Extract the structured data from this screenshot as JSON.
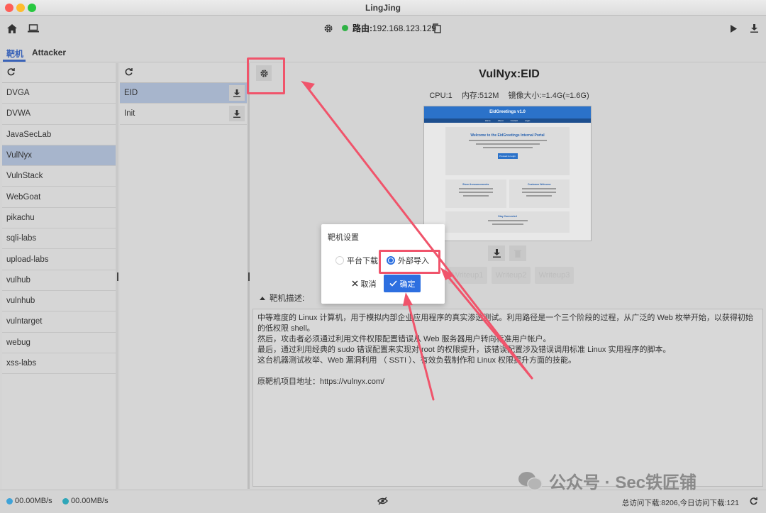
{
  "window": {
    "title": "LingJing"
  },
  "toolbar": {
    "route_label": "路由:",
    "route_ip": "192.168.123.129"
  },
  "tabs": [
    {
      "label": "靶机",
      "active": true
    },
    {
      "label": "Attacker",
      "active": false
    }
  ],
  "targets": {
    "items": [
      "DVGA",
      "DVWA",
      "JavaSecLab",
      "VulNyx",
      "VulnStack",
      "WebGoat",
      "pikachu",
      "sqli-labs",
      "upload-labs",
      "vulhub",
      "vulnhub",
      "vulntarget",
      "webug",
      "xss-labs"
    ],
    "selected": "VulNyx"
  },
  "machines": {
    "items": [
      "EID",
      "Init"
    ],
    "selected": "EID"
  },
  "vm": {
    "title": "VulNyx:EID",
    "cpu": "CPU:1",
    "memory": "内存:512M",
    "image_size": "镜像大小:≈1.4G(≈1.6G)"
  },
  "preview": {
    "header": "EidGreetings v1.0",
    "nav": [
      "Home",
      "About",
      "Contact",
      "Login"
    ],
    "welcome": "Welcome to the EidGreetings Internal Portal",
    "button": "Proceed to Login",
    "left_heading": "Store Announcements",
    "right_heading": "Customer Welcome",
    "bottom_heading": "Stay Connected"
  },
  "writeups": [
    "Writeup1",
    "Writeup2",
    "Writeup3"
  ],
  "description": {
    "header": "靶机描述:",
    "lines": [
      "中等难度的 Linux 计算机，用于模拟内部企业应用程序的真实渗透测试。利用路径是一个三个阶段的过程，从广泛的 Web 枚举开始，以获得初始的低权限 shell。",
      "然后，攻击者必须通过利用文件权限配置错误从 Web 服务器用户转向标准用户帐户。",
      "最后，通过利用经典的 sudo 错误配置来实现对 root 的权限提升，该错误配置涉及错误调用标准 Linux 实用程序的脚本。",
      "这台机器测试枚举、Web 漏洞利用 （ SSTI ）、有效负载制作和 Linux 权限提升方面的技能。"
    ],
    "source": "原靶机项目地址：https://vulnyx.com/"
  },
  "dialog": {
    "title": "靶机设置",
    "option_platform": "平台下载",
    "option_import": "外部导入",
    "selected": "外部导入",
    "cancel": "取消",
    "confirm": "确定"
  },
  "status": {
    "upload_speed": "00.00MB/s",
    "download_speed": "00.00MB/s",
    "visits": "总访问下载:8206,今日访问下载:121"
  },
  "watermark": {
    "text": "公众号 · Sec铁匠铺"
  },
  "colors": {
    "accent": "#2d6fe0",
    "highlight": "#f0546b",
    "selected_row": "#a7b5cc",
    "status_online": "#2fb245"
  }
}
